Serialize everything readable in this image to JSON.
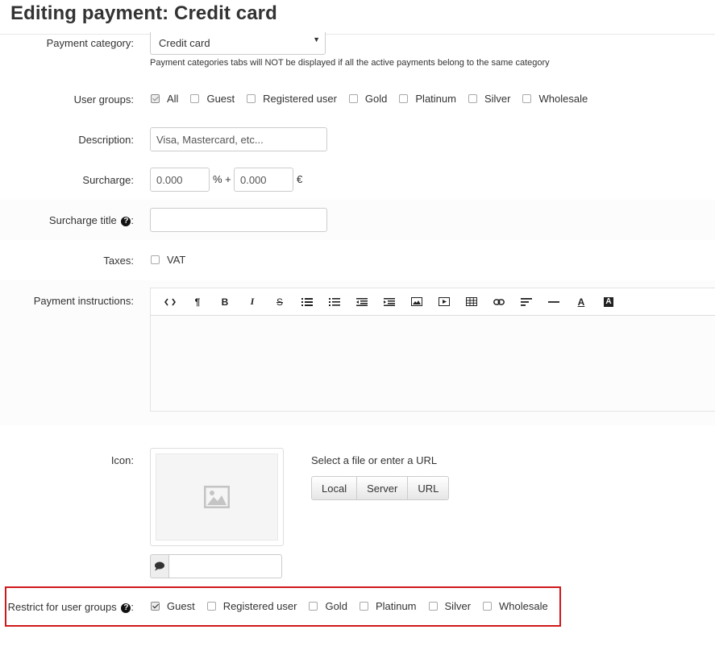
{
  "page": {
    "title": "Editing payment: Credit card"
  },
  "payment_category": {
    "label": "Payment category:",
    "value": "Credit card",
    "hint": "Payment categories tabs will NOT be displayed if all the active payments belong to the same category"
  },
  "user_groups": {
    "label": "User groups:",
    "options": [
      {
        "label": "All",
        "checked": true
      },
      {
        "label": "Guest",
        "checked": false
      },
      {
        "label": "Registered user",
        "checked": false
      },
      {
        "label": "Gold",
        "checked": false
      },
      {
        "label": "Platinum",
        "checked": false
      },
      {
        "label": "Silver",
        "checked": false
      },
      {
        "label": "Wholesale",
        "checked": false
      }
    ]
  },
  "description": {
    "label": "Description:",
    "value": "Visa, Mastercard, etc..."
  },
  "surcharge": {
    "label": "Surcharge:",
    "percent_value": "0.000",
    "percent_sign": "% +",
    "fixed_value": "0.000",
    "currency": "€"
  },
  "surcharge_title": {
    "label": "Surcharge title",
    "suffix": ":",
    "help": "?",
    "value": ""
  },
  "taxes": {
    "label": "Taxes:",
    "options": [
      {
        "label": "VAT",
        "checked": false
      }
    ]
  },
  "payment_instructions": {
    "label": "Payment instructions:",
    "toolbar": [
      "code-view",
      "paragraph",
      "bold",
      "italic",
      "strikethrough",
      "unordered-list",
      "ordered-list",
      "outdent",
      "indent",
      "image",
      "video",
      "table",
      "link",
      "align",
      "horizontal-rule",
      "text-color",
      "background-color"
    ],
    "toolbar_glyphs": {
      "paragraph": "¶",
      "bold": "B",
      "italic": "I",
      "strikethrough": "S",
      "text-color": "A",
      "background-color": "A"
    }
  },
  "icon": {
    "label": "Icon:",
    "select_text": "Select a file or enter a URL",
    "buttons": [
      "Local",
      "Server",
      "URL"
    ],
    "caption_value": ""
  },
  "restrict": {
    "label": "Restrict for user groups",
    "suffix": ":",
    "help": "?",
    "options": [
      {
        "label": "Guest",
        "checked": true
      },
      {
        "label": "Registered user",
        "checked": false
      },
      {
        "label": "Gold",
        "checked": false
      },
      {
        "label": "Platinum",
        "checked": false
      },
      {
        "label": "Silver",
        "checked": false
      },
      {
        "label": "Wholesale",
        "checked": false
      }
    ]
  },
  "colors": {
    "highlight_border": "#d0181a",
    "text": "#333333"
  }
}
